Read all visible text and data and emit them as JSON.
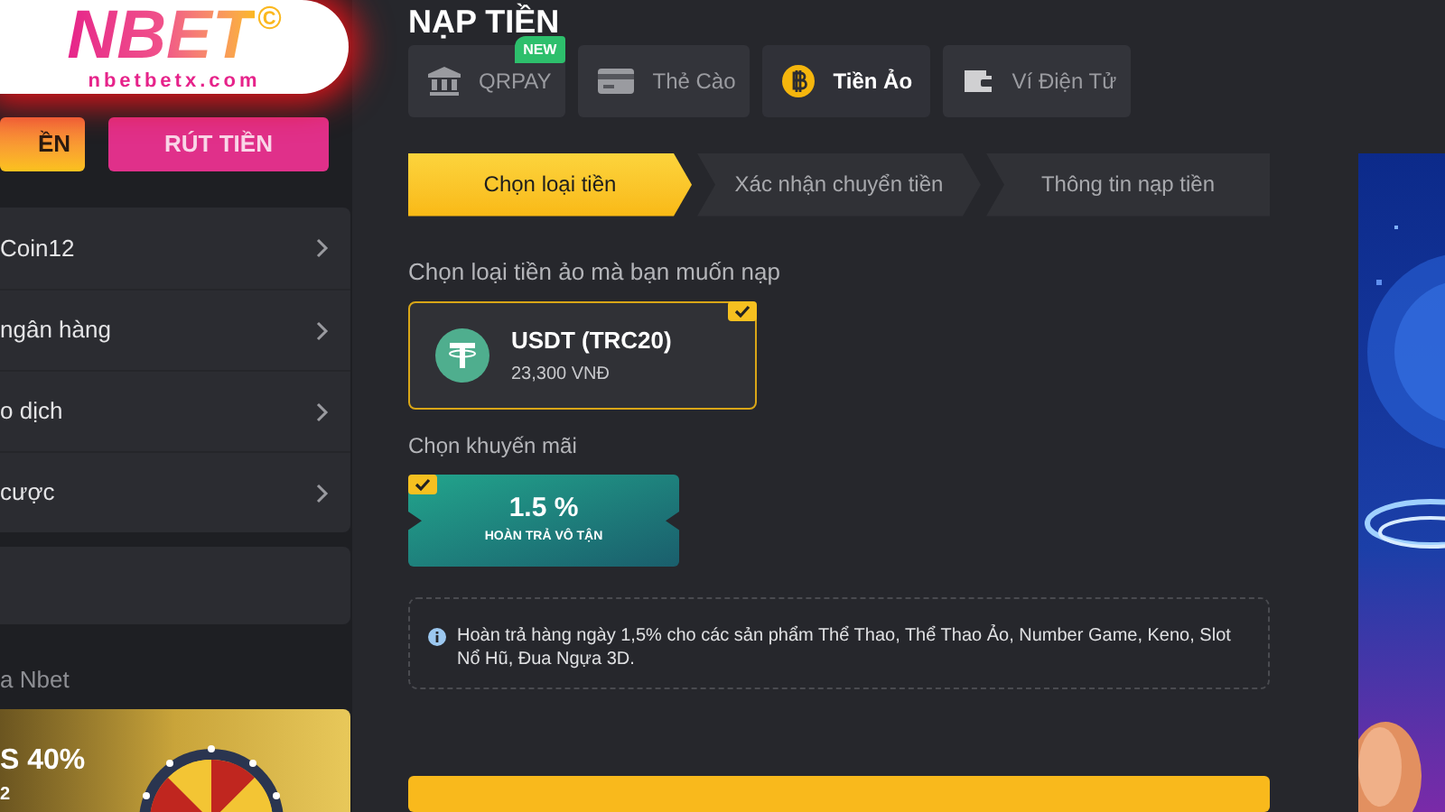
{
  "logo": {
    "brand": "NBET",
    "mark": "©",
    "site": "nbetbetx.com"
  },
  "sidebar": {
    "buttons": [
      {
        "label": "ỀN",
        "kind": "deposit"
      },
      {
        "label": "RÚT TIỀN",
        "kind": "withdraw"
      }
    ],
    "menu": [
      {
        "label": "Coin12"
      },
      {
        "label": "ngân hàng"
      },
      {
        "label": "o dịch"
      },
      {
        "label": "cược"
      }
    ],
    "section_title": "a Nbet",
    "promo": {
      "title": "S 40%",
      "subtitle": "2"
    }
  },
  "page_title": "NẠP TIỀN",
  "tabs": [
    {
      "label": "QRPAY",
      "kind": "bank",
      "badge": "NEW",
      "selected": false
    },
    {
      "label": "Thẻ Cào",
      "kind": "card",
      "selected": false
    },
    {
      "label": "Tiền Ảo",
      "kind": "crypto",
      "selected": true
    },
    {
      "label": "Ví Điện Tử",
      "kind": "wallet",
      "selected": false
    }
  ],
  "steps": [
    {
      "label": "Chọn loại tiền",
      "selected": true
    },
    {
      "label": "Xác nhận chuyển tiền",
      "selected": false
    },
    {
      "label": "Thông tin nạp tiền",
      "selected": false
    }
  ],
  "coin_prompt": "Chọn loại tiền ảo mà bạn muốn nạp",
  "coins": [
    {
      "name": "USDT (TRC20)",
      "rate": "23,300 VNĐ",
      "selected": true
    }
  ],
  "promo_prompt": "Chọn khuyến mãi",
  "promotions": [
    {
      "value": "1.5 %",
      "caption": "HOÀN TRẢ VÔ TẬN",
      "selected": true
    }
  ],
  "info": "Hoàn trả hàng ngày 1,5% cho các sản phẩm Thể Thao, Thể Thao Ảo, Number Game, Keno, Slot Nổ Hũ, Đua Ngựa 3D."
}
